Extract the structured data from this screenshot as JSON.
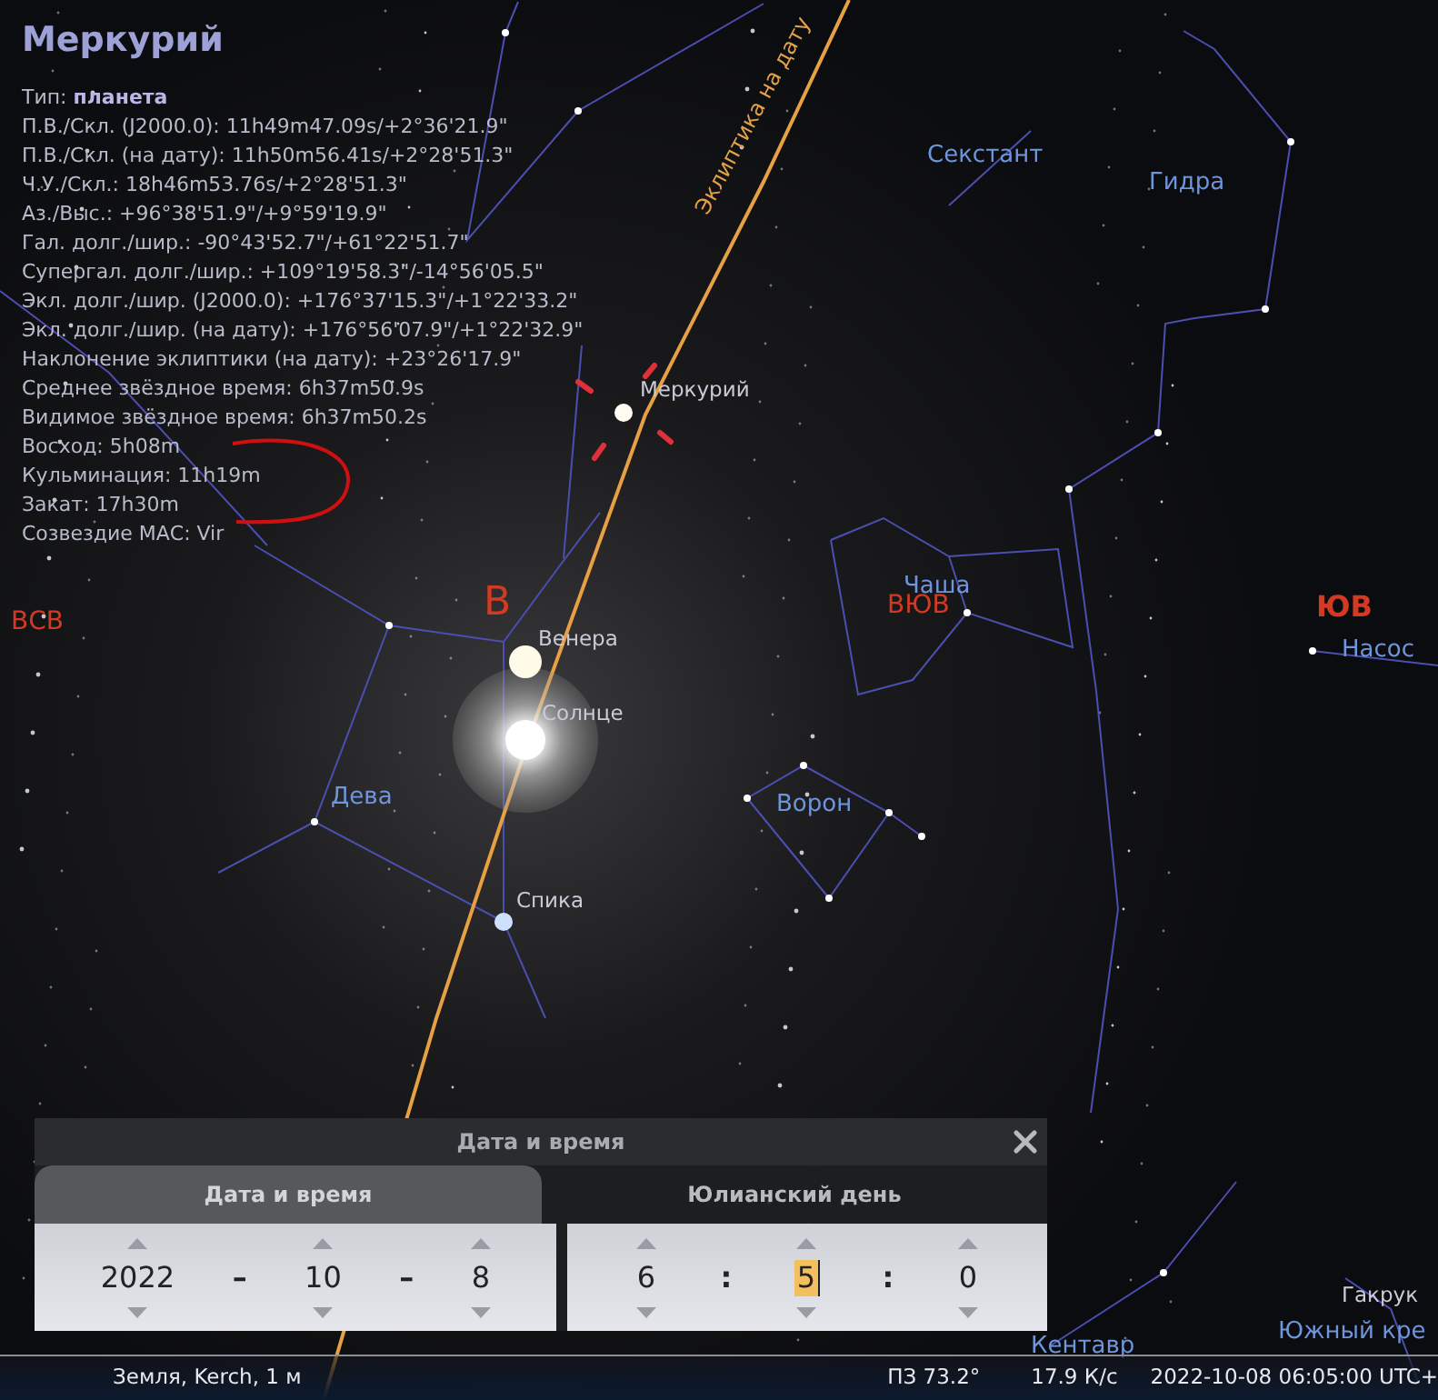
{
  "info_panel": {
    "title": "Меркурий",
    "lines": [
      "Тип: **планета**",
      "П.В./Скл. (J2000.0): 11h49m47.09s/+2°36'21.9\"",
      "П.В./Скл. (на дату): 11h50m56.41s/+2°28'51.3\"",
      "Ч.У./Скл.: 18h46m53.76s/+2°28'51.3\"",
      "Аз./Выс.: +96°38'51.9\"/+9°59'19.9\"",
      "Гал. долг./шир.: -90°43'52.7\"/+61°22'51.7\"",
      "Супергал. долг./шир.: +109°19'58.3\"/-14°56'05.5\"",
      "Экл. долг./шир. (J2000.0): +176°37'15.3\"/+1°22'33.2\"",
      "Экл. долг./шир. (на дату): +176°56'07.9\"/+1°22'32.9\"",
      "Наклонение эклиптики (на дату): +23°26'17.9\"",
      "Среднее звёздное время: 6h37m50.9s",
      "Видимое звёздное время: 6h37m50.2s",
      "Восход: 5h08m",
      "Кульминация: 11h19m",
      "Закат: 17h30m",
      "Созвездие МАС: Vir"
    ]
  },
  "sky": {
    "labels": [
      {
        "text": "Секстант",
        "kind": "constellation"
      },
      {
        "text": "Гидра",
        "kind": "constellation"
      },
      {
        "text": "Чаша",
        "kind": "constellation"
      },
      {
        "text": "ВЮВ",
        "kind": "cardinal"
      },
      {
        "text": "ЮВ",
        "kind": "cardinal"
      },
      {
        "text": "Насос",
        "kind": "constellation"
      },
      {
        "text": "Ворон",
        "kind": "constellation"
      },
      {
        "text": "Дева",
        "kind": "constellation"
      },
      {
        "text": "Меркурий",
        "kind": "object"
      },
      {
        "text": "Венера",
        "kind": "object"
      },
      {
        "text": "Солнце",
        "kind": "object"
      },
      {
        "text": "Спика",
        "kind": "object"
      },
      {
        "text": "В",
        "kind": "cardinal"
      },
      {
        "text": "ВСВ",
        "kind": "cardinal"
      },
      {
        "text": "Гакрук",
        "kind": "object"
      },
      {
        "text": "Южный кре",
        "kind": "constellation"
      },
      {
        "text": "Кентавр",
        "kind": "constellation"
      },
      {
        "text": "Эклиптика на дату",
        "kind": "ecliptic"
      }
    ]
  },
  "dialog": {
    "title": "Дата и время",
    "tabs": [
      {
        "label": "Дата и время",
        "selected": true
      },
      {
        "label": "Юлианский день",
        "selected": false
      }
    ],
    "date": [
      {
        "kind": "field",
        "value": "2022"
      },
      {
        "kind": "separator",
        "text": "–"
      },
      {
        "kind": "field",
        "value": "10"
      },
      {
        "kind": "separator",
        "text": "–"
      },
      {
        "kind": "field",
        "value": "8"
      }
    ],
    "time": [
      {
        "kind": "field",
        "value": "6",
        "selected": false
      },
      {
        "kind": "separator",
        "text": ":"
      },
      {
        "kind": "field",
        "value": "5",
        "selected": true
      },
      {
        "kind": "separator",
        "text": ":"
      },
      {
        "kind": "field",
        "value": "0",
        "selected": false
      }
    ]
  },
  "status_bar": {
    "location": "Земля, Kerch, 1 м",
    "fov": "ПЗ 73.2°",
    "fps": "17.9 К/с",
    "datetime": "2022-10-08 06:05:00 UTC+"
  }
}
